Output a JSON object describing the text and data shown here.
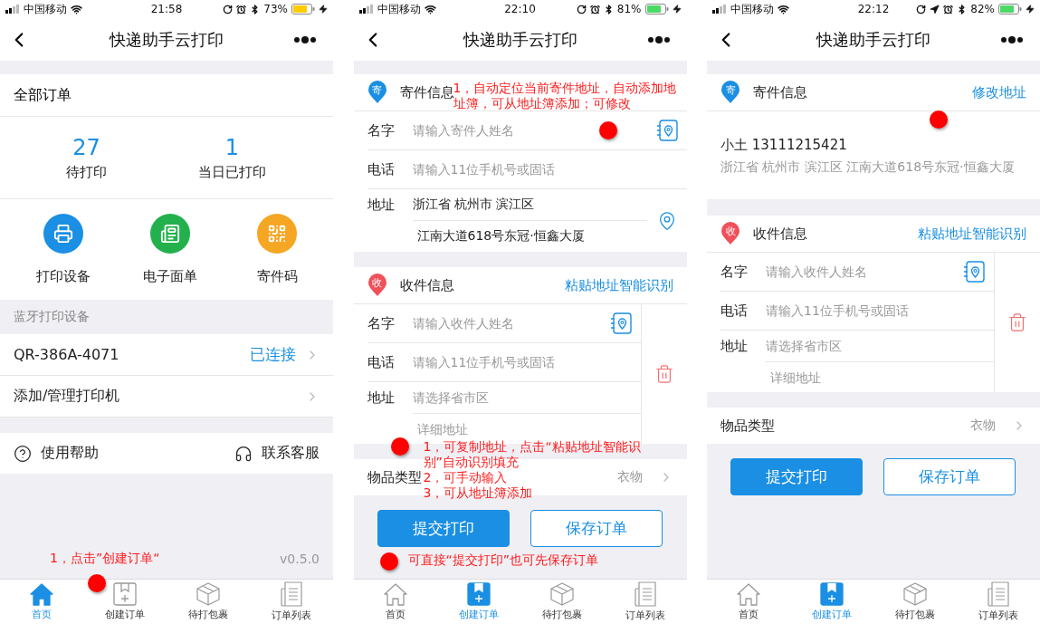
{
  "screens": [
    {
      "kind": "home",
      "status_bar": {
        "carrier": "中国移动",
        "time": "21:58",
        "battery": "73%",
        "low_power_mode": true,
        "location_active": false
      },
      "nav": {
        "title": "快递助手云打印"
      },
      "orders_title": "全部订单",
      "stats": [
        {
          "value": "27",
          "label": "待打印"
        },
        {
          "value": "1",
          "label": "当日已打印"
        }
      ],
      "shortcuts": [
        {
          "kind": "printer",
          "label": "打印设备",
          "color": "#1a8fe3"
        },
        {
          "kind": "waybill",
          "label": "电子面单",
          "color": "#22b14c"
        },
        {
          "kind": "qrcode",
          "label": "寄件码",
          "color": "#f5a623"
        }
      ],
      "devices_header": "蓝牙打印设备",
      "devices": [
        {
          "label": "QR-386A-4071",
          "status": "已连接"
        },
        {
          "label": "添加/管理打印机"
        }
      ],
      "help": [
        {
          "kind": "help",
          "label": "使用帮助"
        },
        {
          "kind": "service",
          "label": "联系客服"
        }
      ],
      "version": "v0.5.0",
      "note": "1，点击”创建订单“",
      "tab_bar": [
        {
          "kind": "home",
          "label": "首页",
          "selected": true,
          "marked": false
        },
        {
          "kind": "create",
          "label": "创建订单",
          "selected": false,
          "marked": true
        },
        {
          "kind": "parcel",
          "label": "待打包裹",
          "selected": false,
          "marked": false
        },
        {
          "kind": "list",
          "label": "订单列表",
          "selected": false,
          "marked": false
        }
      ]
    },
    {
      "kind": "order_form",
      "status_bar": {
        "carrier": "中国移动",
        "time": "22:10",
        "battery": "81%",
        "low_power_mode": false,
        "location_active": false
      },
      "nav": {
        "title": "快递助手云打印"
      },
      "sender": {
        "kind": "form",
        "badge": "寄",
        "title": "寄件信息",
        "note": "1，自动定位当前寄件地址，自动添加地址簿，可从地址簿添加；可修改",
        "fields": [
          {
            "kind": "name",
            "label": "名字",
            "placeholder": "请输入寄件人姓名",
            "marked": true
          },
          {
            "kind": "phone",
            "label": "电话",
            "placeholder": "请输入11位手机号或固话",
            "marked": false
          },
          {
            "kind": "address",
            "label": "地址",
            "value": "浙江省 杭州市 滨江区",
            "detail_value": "江南大道618号东冠·恒鑫大厦",
            "marked": false
          }
        ]
      },
      "receiver": {
        "badge": "收",
        "title": "收件信息",
        "action": "粘贴地址智能识别",
        "fields": [
          {
            "kind": "name",
            "label": "名字",
            "placeholder": "请输入收件人姓名"
          },
          {
            "kind": "phone",
            "label": "电话",
            "placeholder": "请输入11位手机号或固话"
          },
          {
            "kind": "address",
            "label": "地址",
            "placeholder": "请选择省市区",
            "detail_placeholder": "详细地址"
          }
        ],
        "notes": [
          "1，可复制地址，点击“粘贴地址智能识别”自动识别填充",
          "2，可手动输入",
          "3，可从地址簿添加"
        ]
      },
      "item_type": {
        "label": "物品类型",
        "value": "衣物"
      },
      "buttons": [
        {
          "kind": "primary",
          "label": "提交打印"
        },
        {
          "kind": "outline",
          "label": "保存订单"
        }
      ],
      "submit_note": "可直接“提交打印”也可先保存订单",
      "tab_bar": [
        {
          "kind": "home",
          "label": "首页",
          "selected": false,
          "marked": false
        },
        {
          "kind": "create",
          "label": "创建订单",
          "selected": true,
          "marked": false
        },
        {
          "kind": "parcel",
          "label": "待打包裹",
          "selected": false,
          "marked": false
        },
        {
          "kind": "list",
          "label": "订单列表",
          "selected": false,
          "marked": false
        }
      ]
    },
    {
      "kind": "order_form",
      "status_bar": {
        "carrier": "中国移动",
        "time": "22:12",
        "battery": "82%",
        "low_power_mode": false,
        "location_active": true
      },
      "nav": {
        "title": "快递助手云打印"
      },
      "sender": {
        "kind": "summary",
        "badge": "寄",
        "title": "寄件信息",
        "action": "修改地址",
        "marked": true,
        "contact": "小土 13111215421",
        "address": "浙江省 杭州市 滨江区 江南大道618号东冠·恒鑫大厦"
      },
      "receiver": {
        "badge": "收",
        "title": "收件信息",
        "action": "粘贴地址智能识别",
        "fields": [
          {
            "kind": "name",
            "label": "名字",
            "placeholder": "请输入收件人姓名"
          },
          {
            "kind": "phone",
            "label": "电话",
            "placeholder": "请输入11位手机号或固话"
          },
          {
            "kind": "address",
            "label": "地址",
            "placeholder": "请选择省市区",
            "detail_placeholder": "详细地址"
          }
        ]
      },
      "item_type": {
        "label": "物品类型",
        "value": "衣物"
      },
      "buttons": [
        {
          "kind": "primary",
          "label": "提交打印"
        },
        {
          "kind": "outline",
          "label": "保存订单"
        }
      ],
      "tab_bar": [
        {
          "kind": "home",
          "label": "首页",
          "selected": false,
          "marked": false
        },
        {
          "kind": "create",
          "label": "创建订单",
          "selected": true,
          "marked": false
        },
        {
          "kind": "parcel",
          "label": "待打包裹",
          "selected": false,
          "marked": false
        },
        {
          "kind": "list",
          "label": "订单列表",
          "selected": false,
          "marked": false
        }
      ]
    }
  ]
}
